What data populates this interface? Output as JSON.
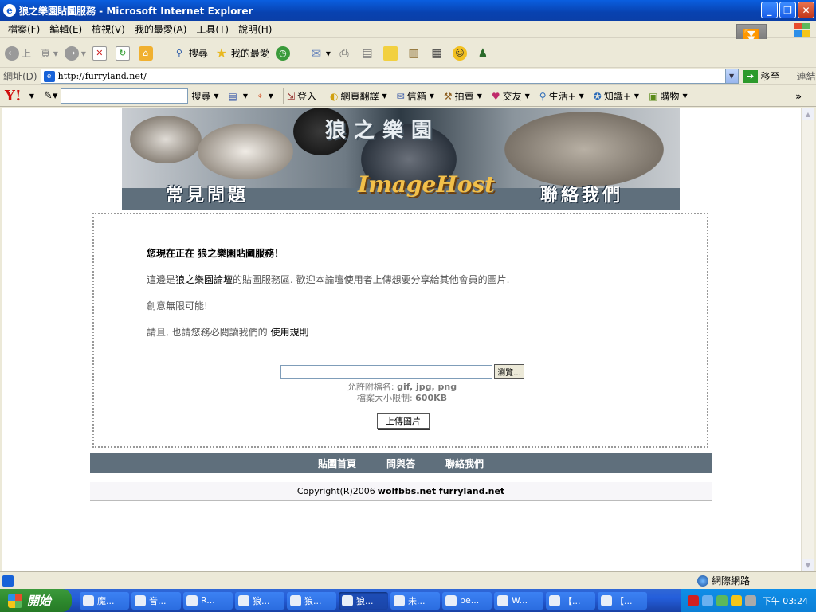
{
  "window": {
    "title": "狼之樂園貼圖服務 - Microsoft Internet Explorer",
    "minimize": "_",
    "maximize": "❐",
    "close": "✕"
  },
  "menu": [
    "檔案(F)",
    "編輯(E)",
    "檢視(V)",
    "我的最愛(A)",
    "工具(T)",
    "說明(H)"
  ],
  "toolbar": {
    "back": "上一頁",
    "search": "搜尋",
    "favorites": "我的最愛"
  },
  "address": {
    "label": "網址(D)",
    "url": "http://furryland.net/",
    "go": "移至",
    "links": "連結"
  },
  "yahoo_bar": {
    "search_btn": "搜尋",
    "login": "登入",
    "translate": "網頁翻譯",
    "mail": "信箱",
    "auction": "拍賣",
    "friends": "交友",
    "life": "生活+",
    "knowledge": "知識+",
    "shopping": "購物",
    "more": "»"
  },
  "banner": {
    "faq": "常見問題",
    "site_name": "狼之樂園",
    "logo": "ImageHost",
    "contact": "聯絡我們"
  },
  "main": {
    "heading": "您現在正在 狼之樂園貼圖服務！",
    "intro_pre": "這邊是",
    "forum_name": "狼之樂園論壇",
    "intro_post": "的貼圖服務區. 歡迎本論壇使用者上傳想要分享給其他會員的圖片.",
    "slogan": "創意無限可能!",
    "rules_pre": "請且, 也請您務必閱讀我們的",
    "rules_link": "使用規則",
    "browse_btn": "瀏覽...",
    "allowed_label": "允許附檔名: ",
    "allowed_value": "gif, jpg, png",
    "size_label": "檔案大小限制: ",
    "size_value": "600KB",
    "upload_btn": "上傳圖片"
  },
  "footer_nav": [
    "貼圖首頁",
    "問與答",
    "聯絡我們"
  ],
  "footer": {
    "copyright": "Copyright(R)2006",
    "sites": "wolfbbs.net furryland.net"
  },
  "status": {
    "zone": "網際網路"
  },
  "taskbar": {
    "start": "開始",
    "tasks": [
      "魔...",
      "音...",
      "R...",
      "狼...",
      "狼...",
      "狼...",
      "未...",
      "be...",
      "W...",
      "【...",
      "【..."
    ],
    "active_index": 5,
    "clock": "下午 03:24"
  }
}
